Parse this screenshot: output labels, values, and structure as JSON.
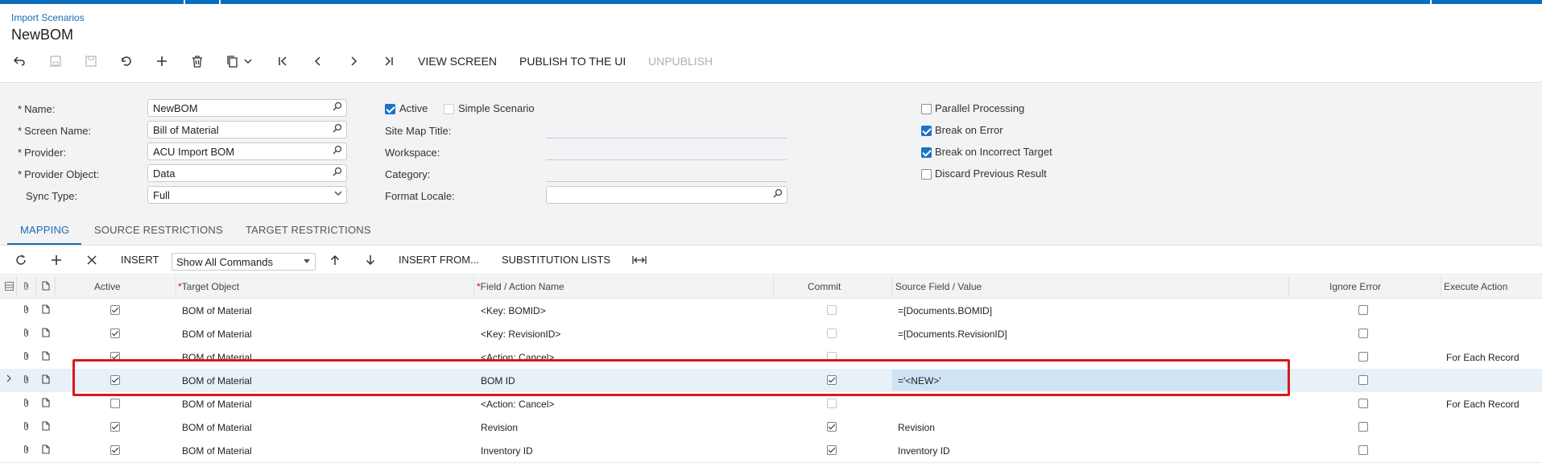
{
  "header": {
    "breadcrumb": "Import Scenarios",
    "title": "NewBOM"
  },
  "toolbar": {
    "view_screen": "VIEW SCREEN",
    "publish": "PUBLISH TO THE UI",
    "unpublish": "UNPUBLISH"
  },
  "form": {
    "name_label": "Name:",
    "name_value": "NewBOM",
    "screen_name_label": "Screen Name:",
    "screen_name_value": "Bill of Material",
    "provider_label": "Provider:",
    "provider_value": "ACU Import BOM",
    "provider_object_label": "Provider Object:",
    "provider_object_value": "Data",
    "sync_type_label": "Sync Type:",
    "sync_type_value": "Full",
    "active_label": "Active",
    "simple_scenario_label": "Simple Scenario",
    "site_map_title_label": "Site Map Title:",
    "workspace_label": "Workspace:",
    "category_label": "Category:",
    "format_locale_label": "Format Locale:",
    "parallel_processing_label": "Parallel Processing",
    "break_on_error_label": "Break on Error",
    "break_on_incorrect_target_label": "Break on Incorrect Target",
    "discard_previous_result_label": "Discard Previous Result",
    "required_marker": "*"
  },
  "tabs": {
    "mapping": "MAPPING",
    "source_restrictions": "SOURCE RESTRICTIONS",
    "target_restrictions": "TARGET RESTRICTIONS"
  },
  "grid_toolbar": {
    "insert": "INSERT",
    "show_commands": "Show All Commands",
    "insert_from": "INSERT FROM...",
    "substitution_lists": "SUBSTITUTION LISTS"
  },
  "grid": {
    "headers": {
      "active": "Active",
      "target_object": "Target Object",
      "field_action": "Field / Action Name",
      "commit": "Commit",
      "source_field": "Source Field / Value",
      "ignore_error": "Ignore Error",
      "execute_action": "Execute Action"
    },
    "rows": [
      {
        "target": "BOM of Material",
        "field": "<Key: BOMID>",
        "source": "=[Documents.BOMID]",
        "execute": ""
      },
      {
        "target": "BOM of Material",
        "field": "<Key: RevisionID>",
        "source": "=[Documents.RevisionID]",
        "execute": ""
      },
      {
        "target": "BOM of Material",
        "field": "<Action: Cancel>",
        "source": "",
        "execute": "For Each Record"
      },
      {
        "target": "BOM of Material",
        "field": "BOM ID",
        "source": "='<NEW>'",
        "execute": ""
      },
      {
        "target": "BOM of Material",
        "field": "<Action: Cancel>",
        "source": "",
        "execute": "For Each Record"
      },
      {
        "target": "BOM of Material",
        "field": "Revision",
        "source": "Revision",
        "execute": ""
      },
      {
        "target": "BOM of Material",
        "field": "Inventory ID",
        "source": "Inventory ID",
        "execute": ""
      }
    ]
  },
  "colors": {
    "accent": "#0a6ebd",
    "highlight_box": "#d7191c",
    "checkbox_on": "#1a73c4"
  },
  "icons": [
    "back-icon",
    "save-icon",
    "save-close-icon",
    "undo-icon",
    "add-icon",
    "delete-icon",
    "copy-paste-icon",
    "first-icon",
    "prev-icon",
    "next-icon",
    "last-icon",
    "refresh-icon",
    "close-icon",
    "arrow-up-icon",
    "arrow-down-icon",
    "fit-columns-icon",
    "search-icon",
    "chevron-down-icon",
    "attachment-icon",
    "note-icon"
  ]
}
